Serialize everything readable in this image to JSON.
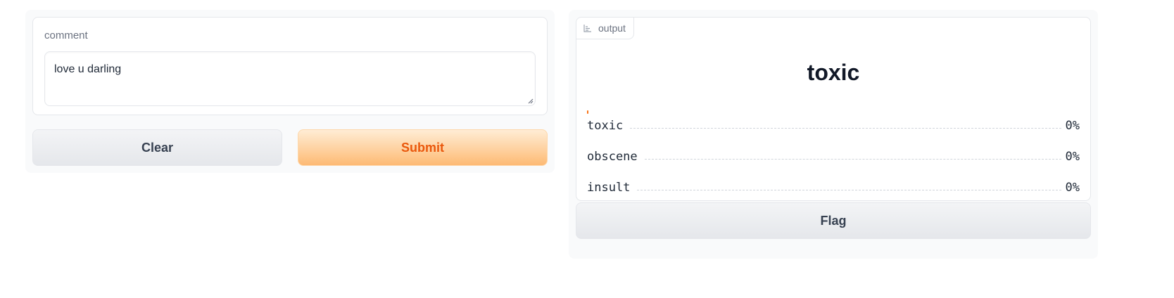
{
  "input": {
    "label": "comment",
    "value": "love u darling"
  },
  "buttons": {
    "clear": "Clear",
    "submit": "Submit",
    "flag": "Flag"
  },
  "output": {
    "tag": "output",
    "label": "toxic",
    "confidences": [
      {
        "label": "toxic",
        "value": "0%"
      },
      {
        "label": "obscene",
        "value": "0%"
      },
      {
        "label": "insult",
        "value": "0%"
      }
    ]
  },
  "colors": {
    "accent": "#ea580c",
    "bar": "#f97316"
  }
}
